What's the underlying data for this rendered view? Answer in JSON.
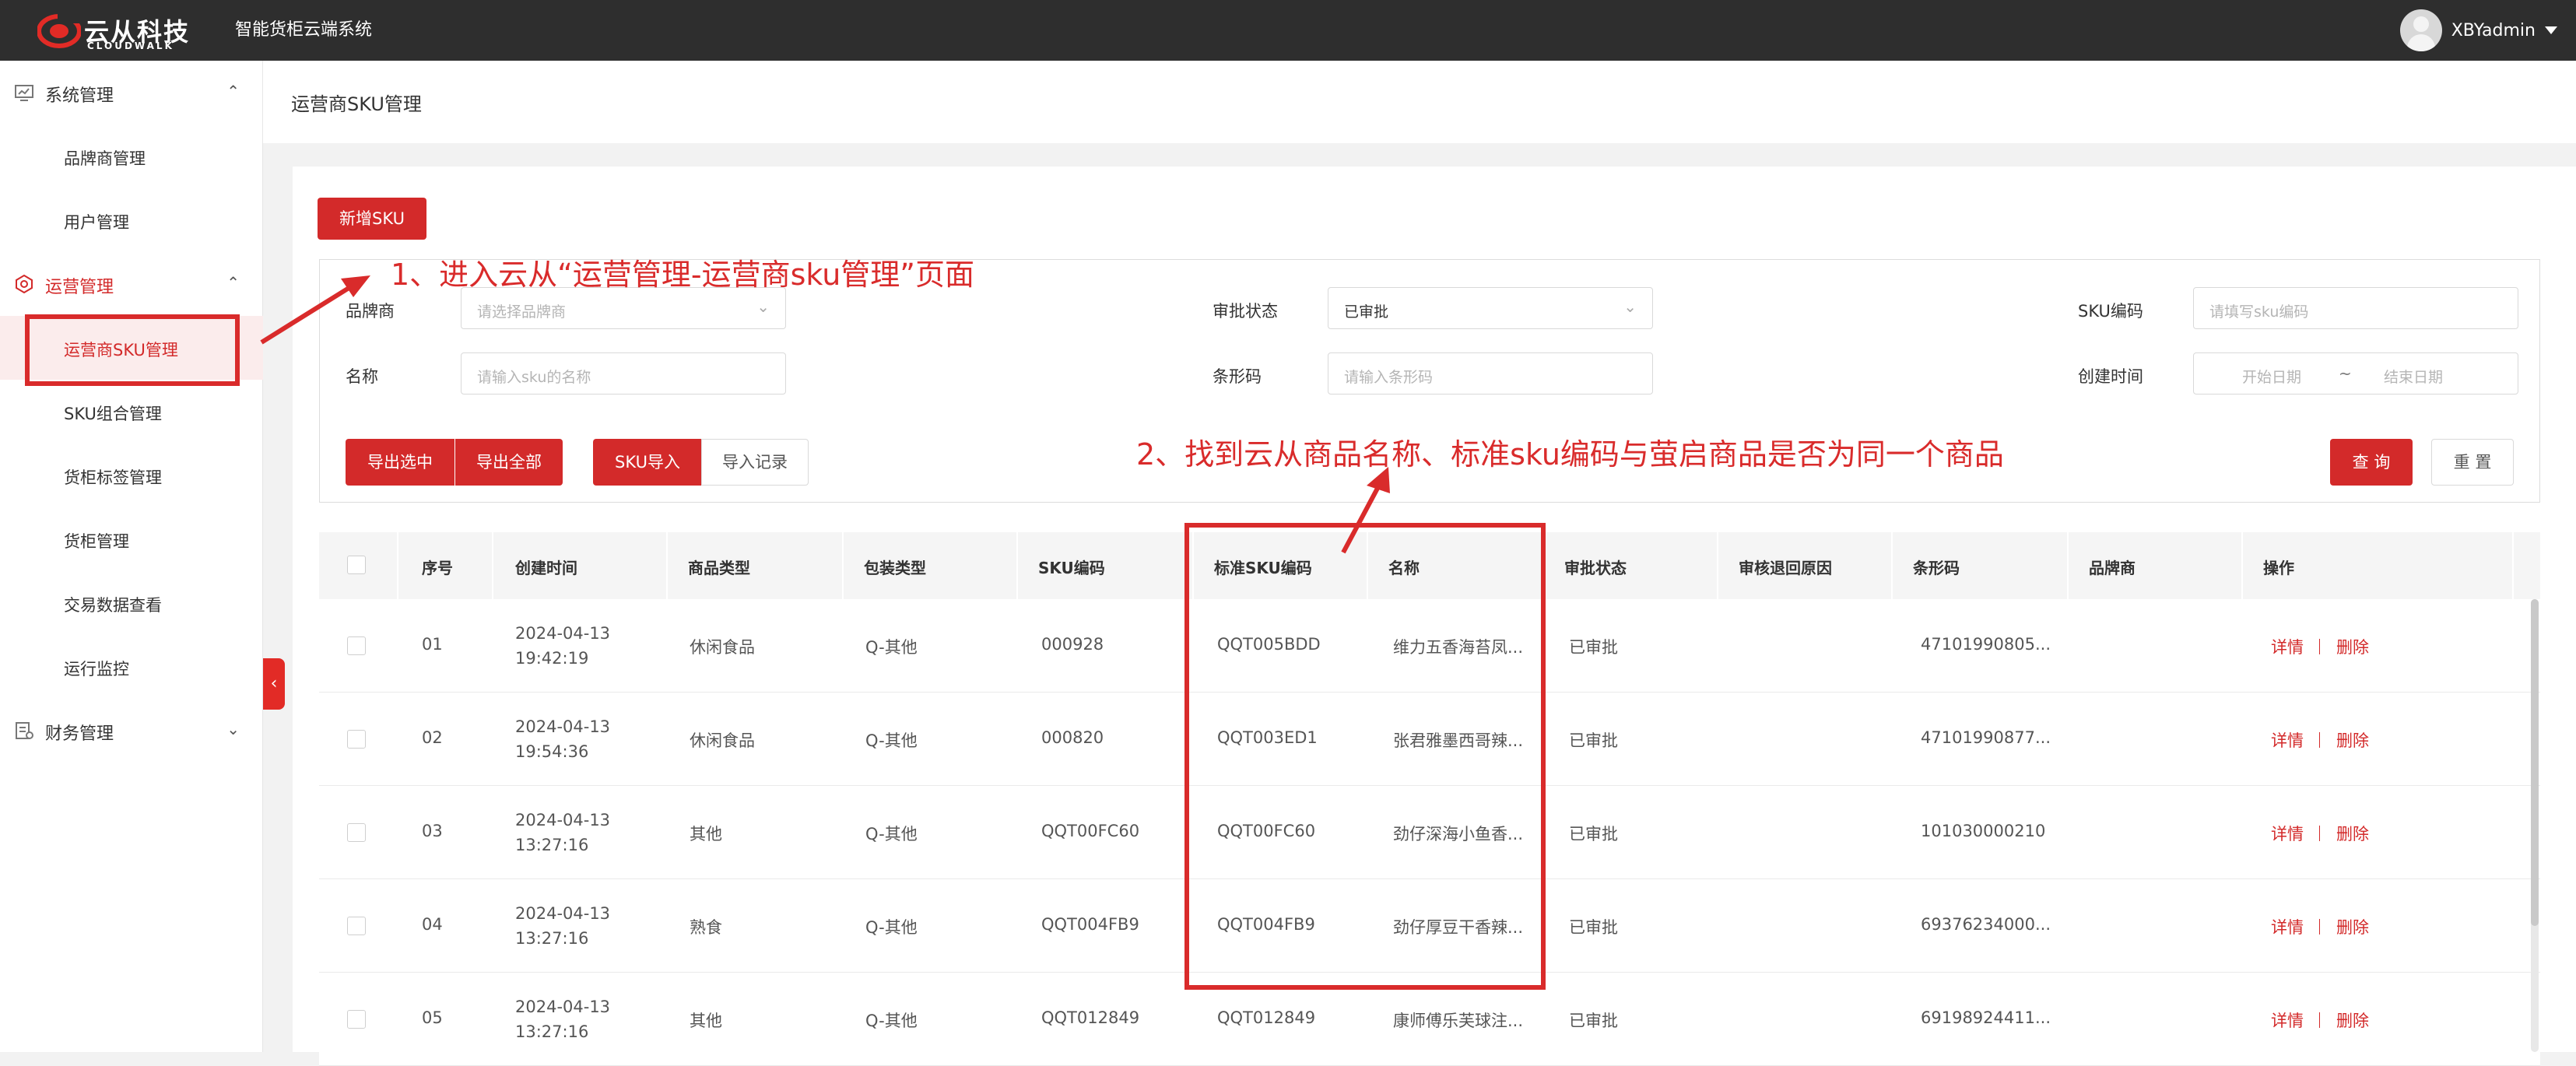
{
  "header": {
    "logo_text": "云从科技",
    "logo_sub": "CLOUDWALK",
    "system_title": "智能货柜云端系统",
    "user_name": "XBYadmin"
  },
  "sidebar": {
    "groups": [
      {
        "label": "系统管理",
        "icon": "monitor-icon",
        "arrow": "⌃",
        "items": [
          "品牌商管理",
          "用户管理"
        ]
      },
      {
        "label": "运营管理",
        "icon": "gear-icon",
        "arrow": "⌃",
        "items": [
          "运营商SKU管理",
          "SKU组合管理",
          "货柜标签管理",
          "货柜管理",
          "交易数据查看",
          "运行监控"
        ]
      },
      {
        "label": "财务管理",
        "icon": "finance-icon",
        "arrow": "⌄",
        "items": []
      }
    ],
    "active_item": "运营商SKU管理",
    "collapse_icon": "‹"
  },
  "breadcrumb": "运营商SKU管理",
  "toolbar": {
    "add_sku": "新增SKU",
    "export_selected": "导出选中",
    "export_all": "导出全部",
    "sku_import": "SKU导入",
    "import_records": "导入记录",
    "query": "查 询",
    "reset": "重 置"
  },
  "filters": {
    "brand_label": "品牌商",
    "brand_placeholder": "请选择品牌商",
    "approval_label": "审批状态",
    "approval_value": "已审批",
    "sku_code_label": "SKU编码",
    "sku_code_placeholder": "请填写sku编码",
    "name_label": "名称",
    "name_placeholder": "请输入sku的名称",
    "barcode_label": "条形码",
    "barcode_placeholder": "请输入条形码",
    "created_label": "创建时间",
    "start_date": "开始日期",
    "date_sep": "~",
    "end_date": "结束日期"
  },
  "table": {
    "headers": [
      "序号",
      "创建时间",
      "商品类型",
      "包装类型",
      "SKU编码",
      "标准SKU编码",
      "名称",
      "审批状态",
      "审核退回原因",
      "条形码",
      "品牌商",
      "操作"
    ],
    "rows": [
      {
        "no": "01",
        "date": "2024-04-13",
        "time": "19:42:19",
        "type": "休闲食品",
        "pack": "Q-其他",
        "sku": "000928",
        "std_sku": "QQT005BDD",
        "name": "维力五香海苔凤...",
        "status": "已审批",
        "reason": "",
        "barcode": "47101990805...",
        "brand": "",
        "detail": "详情",
        "delete": "删除"
      },
      {
        "no": "02",
        "date": "2024-04-13",
        "time": "19:54:36",
        "type": "休闲食品",
        "pack": "Q-其他",
        "sku": "000820",
        "std_sku": "QQT003ED1",
        "name": "张君雅墨西哥辣...",
        "status": "已审批",
        "reason": "",
        "barcode": "47101990877...",
        "brand": "",
        "detail": "详情",
        "delete": "删除"
      },
      {
        "no": "03",
        "date": "2024-04-13",
        "time": "13:27:16",
        "type": "其他",
        "pack": "Q-其他",
        "sku": "QQT00FC60",
        "std_sku": "QQT00FC60",
        "name": "劲仔深海小鱼香...",
        "status": "已审批",
        "reason": "",
        "barcode": "101030000210",
        "brand": "",
        "detail": "详情",
        "delete": "删除"
      },
      {
        "no": "04",
        "date": "2024-04-13",
        "time": "13:27:16",
        "type": "熟食",
        "pack": "Q-其他",
        "sku": "QQT004FB9",
        "std_sku": "QQT004FB9",
        "name": "劲仔厚豆干香辣...",
        "status": "已审批",
        "reason": "",
        "barcode": "69376234000...",
        "brand": "",
        "detail": "详情",
        "delete": "删除"
      },
      {
        "no": "05",
        "date": "2024-04-13",
        "time": "13:27:16",
        "type": "其他",
        "pack": "Q-其他",
        "sku": "QQT012849",
        "std_sku": "QQT012849",
        "name": "康师傅乐芙球注...",
        "status": "已审批",
        "reason": "",
        "barcode": "69198924411...",
        "brand": "",
        "detail": "详情",
        "delete": "删除"
      }
    ]
  },
  "annotations": {
    "step1": "1、进入云从“运营管理-运营商sku管理”页面",
    "step2": "2、找到云从商品名称、标准sku编码与萤启商品是否为同一个商品",
    "color": "#d92b2b"
  }
}
